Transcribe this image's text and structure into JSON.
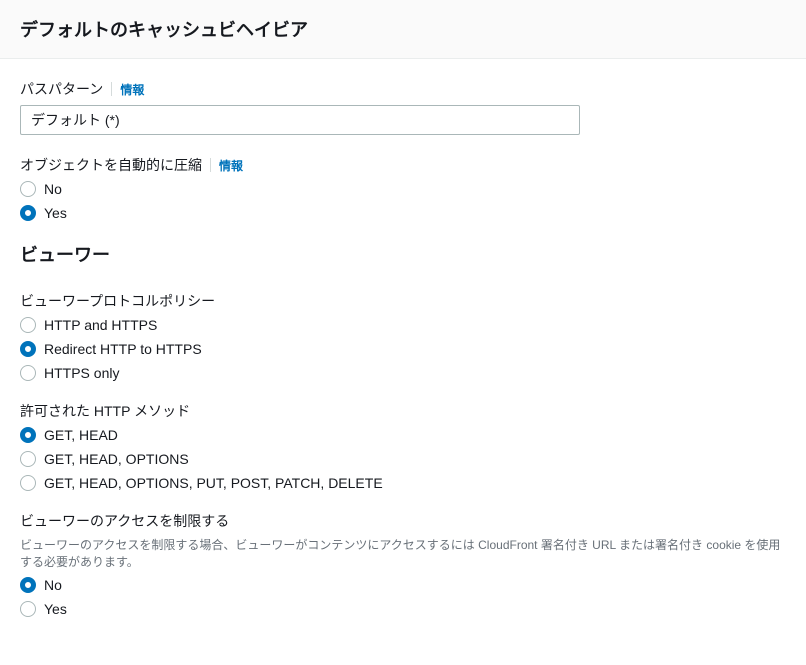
{
  "header": {
    "title": "デフォルトのキャッシュビヘイビア"
  },
  "pathPattern": {
    "label": "パスパターン",
    "infoLabel": "情報",
    "value": "デフォルト (*)"
  },
  "compress": {
    "label": "オブジェクトを自動的に圧縮",
    "infoLabel": "情報",
    "options": {
      "no": "No",
      "yes": "Yes"
    },
    "selected": "yes"
  },
  "viewer": {
    "sectionTitle": "ビューワー"
  },
  "protocolPolicy": {
    "label": "ビューワープロトコルポリシー",
    "options": {
      "httpAndHttps": "HTTP and HTTPS",
      "redirect": "Redirect HTTP to HTTPS",
      "httpsOnly": "HTTPS only"
    },
    "selected": "redirect"
  },
  "httpMethods": {
    "label": "許可された HTTP メソッド",
    "options": {
      "getHead": "GET, HEAD",
      "getHeadOptions": "GET, HEAD, OPTIONS",
      "all": "GET, HEAD, OPTIONS, PUT, POST, PATCH, DELETE"
    },
    "selected": "getHead"
  },
  "restrictAccess": {
    "label": "ビューワーのアクセスを制限する",
    "helpText": "ビューワーのアクセスを制限する場合、ビューワーがコンテンツにアクセスするには CloudFront 署名付き URL または署名付き cookie を使用する必要があります。",
    "options": {
      "no": "No",
      "yes": "Yes"
    },
    "selected": "no"
  }
}
